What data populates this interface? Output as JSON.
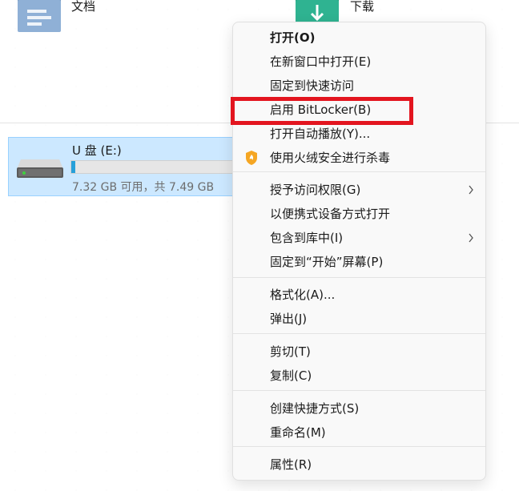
{
  "folders": [
    {
      "name": "文档",
      "icon": "documents-folder-icon"
    },
    {
      "name": "下载",
      "icon": "downloads-folder-icon"
    }
  ],
  "drive": {
    "name": "U 盘 (E:)",
    "space_text": "7.32 GB 可用，共 7.49 GB",
    "used_fraction": 0.023,
    "icon": "usb-drive-icon",
    "bar_color": "#26a0da"
  },
  "context_menu": {
    "items": [
      {
        "label": "打开(O)",
        "bold": true
      },
      {
        "label": "在新窗口中打开(E)"
      },
      {
        "label": "固定到快速访问"
      },
      {
        "label": "启用 BitLocker(B)",
        "highlighted": true
      },
      {
        "label": "打开自动播放(Y)..."
      },
      {
        "label": "使用火绒安全进行杀毒",
        "icon": "huorong-shield-icon"
      },
      {
        "label": "授予访问权限(G)",
        "submenu": true
      },
      {
        "label": "以便携式设备方式打开"
      },
      {
        "label": "包含到库中(I)",
        "submenu": true
      },
      {
        "label": "固定到“开始”屏幕(P)"
      },
      {
        "label": "格式化(A)..."
      },
      {
        "label": "弹出(J)"
      },
      {
        "label": "剪切(T)"
      },
      {
        "label": "复制(C)"
      },
      {
        "label": "创建快捷方式(S)"
      },
      {
        "label": "重命名(M)"
      },
      {
        "label": "属性(R)"
      }
    ],
    "highlight_color": "#e3151f"
  }
}
